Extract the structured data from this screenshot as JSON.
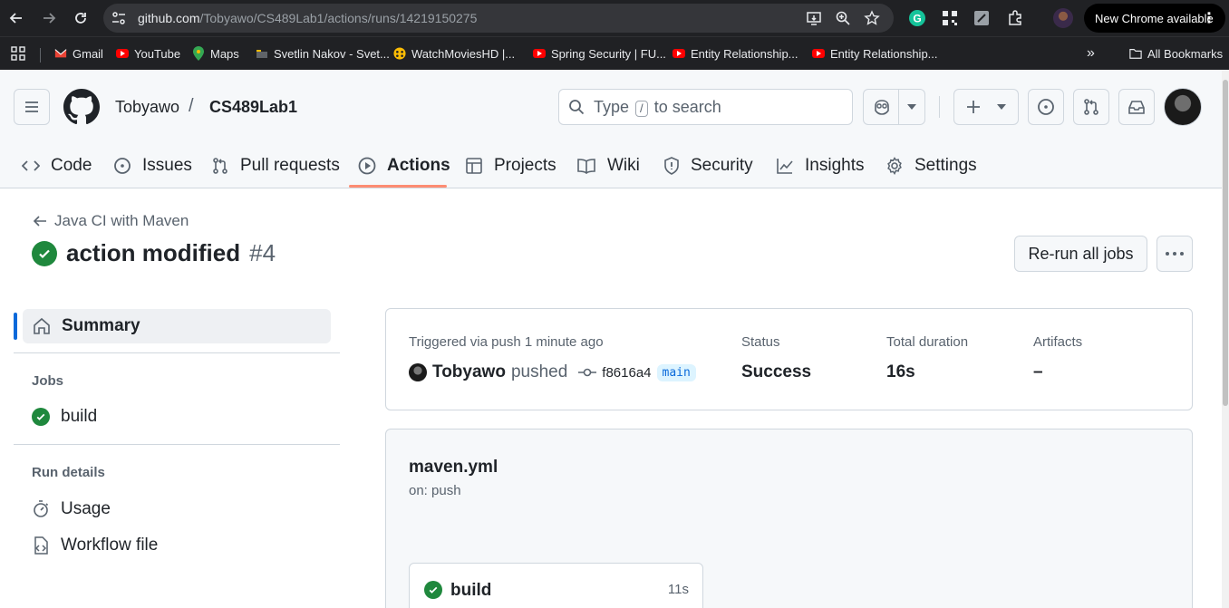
{
  "browser": {
    "url_host": "github.com",
    "url_path": "/Tobyawo/CS489Lab1/actions/runs/14219150275",
    "update_label": "New Chrome available",
    "bookmarks": [
      {
        "label": "Gmail",
        "icon": "gmail-icon"
      },
      {
        "label": "YouTube",
        "icon": "youtube-icon"
      },
      {
        "label": "Maps",
        "icon": "maps-icon"
      },
      {
        "label": "Svetlin Nakov - Svet...",
        "icon": "bookmark-favicon"
      },
      {
        "label": "WatchMoviesHD |...",
        "icon": "watchmovies-icon"
      },
      {
        "label": "Spring Security | FU...",
        "icon": "youtube-icon"
      },
      {
        "label": "Entity Relationship...",
        "icon": "youtube-icon"
      },
      {
        "label": "Entity Relationship...",
        "icon": "youtube-icon"
      }
    ],
    "all_bookmarks": "All Bookmarks"
  },
  "header": {
    "owner": "Tobyawo",
    "separator": "/",
    "repo": "CS489Lab1",
    "search_before": "Type",
    "search_key": "/",
    "search_after": "to search"
  },
  "tabs": [
    {
      "label": "Code",
      "icon": "code-icon"
    },
    {
      "label": "Issues",
      "icon": "issue-icon"
    },
    {
      "label": "Pull requests",
      "icon": "pull-request-icon"
    },
    {
      "label": "Actions",
      "icon": "play-icon",
      "active": true
    },
    {
      "label": "Projects",
      "icon": "table-icon"
    },
    {
      "label": "Wiki",
      "icon": "book-icon"
    },
    {
      "label": "Security",
      "icon": "shield-icon"
    },
    {
      "label": "Insights",
      "icon": "graph-icon"
    },
    {
      "label": "Settings",
      "icon": "gear-icon"
    }
  ],
  "run": {
    "workflow_link": "Java CI with Maven",
    "title": "action modified",
    "number": "#4",
    "rerun_label": "Re-run all jobs"
  },
  "sidebar": {
    "summary": "Summary",
    "jobs_heading": "Jobs",
    "job": "build",
    "details_heading": "Run details",
    "usage": "Usage",
    "workflow_file": "Workflow file"
  },
  "summary_card": {
    "trigger": "Triggered via push 1 minute ago",
    "actor": "Tobyawo",
    "action": "pushed",
    "commit": "f8616a4",
    "branch": "main",
    "status_label": "Status",
    "status_value": "Success",
    "duration_label": "Total duration",
    "duration_value": "16s",
    "artifacts_label": "Artifacts",
    "artifacts_value": "–"
  },
  "workflow_card": {
    "file": "maven.yml",
    "trigger": "on: push",
    "job_name": "build",
    "job_duration": "11s"
  },
  "colors": {
    "success": "#1f883d",
    "active_tab_underline": "#fd8c73",
    "accent": "#0969da"
  }
}
